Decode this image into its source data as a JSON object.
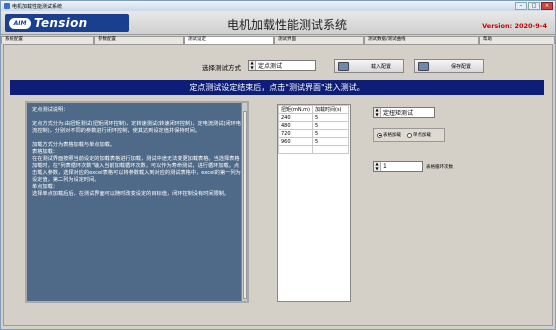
{
  "window": {
    "title": "电机加载性能测试系统"
  },
  "header": {
    "logo_mark": "AIM",
    "logo_text": "Tension",
    "app_title": "电机加载性能测试系统",
    "version": "Version: 2020-9-4"
  },
  "tabs": [
    "系统配置",
    "参数配置",
    "测试设定",
    "测试界面",
    "测试数据/测试曲线",
    "帮助"
  ],
  "active_tab": 2,
  "mode": {
    "label": "选择测试方式",
    "value": "定点测试"
  },
  "buttons": {
    "load": "载入配置",
    "save": "保存配置"
  },
  "banner": "定点测试设定结束后，点击\"测试界面\"进入测试。",
  "description": "定点测试说明：\n\n定点方式分为:由扭矩测试(扭矩闭环控制)，定转速测试(转速闭环控制)，定电流测试(闭环电流控制)，分别对不同的参数进行闭环控制，使其达到设定值并保持时间。\n\n加载方式分为表格加载与单点加载。\n表格加载：\n在在测试界面按照当前设定的加载表格进行加载，测试中途无法变更加载表格。当选择表格加载时，在\"列表循环次数\"输入当前加载循环次数，可以作为寿命测试，进行循环加载。点击载入参数，选择对应的excel表格可以将参数载入到对应的测试表格中，excel的第一列为设定值，第二列为设定时间。\n单点加载：\n选择单点加载后后，在测试界面可以随时改变设定的目标值，闭环控制没有时间限制。",
  "table": {
    "headers": [
      "扭矩(mN.m)",
      "加载时间(s)"
    ],
    "rows": [
      [
        "240",
        "5"
      ],
      [
        "480",
        "5"
      ],
      [
        "720",
        "5"
      ],
      [
        "960",
        "5"
      ]
    ]
  },
  "control_select": "定扭矩测试",
  "load_mode": {
    "options": [
      "表格加载",
      "单点加载"
    ],
    "selected": 0
  },
  "loop": {
    "value": "1",
    "label": "表格循环次数"
  },
  "colors": {
    "banner": "#0e1e78",
    "description_bg": "#4f6a88",
    "version": "#cc0000",
    "logo": "#1a3f8f"
  },
  "icons": {
    "load": "load-config-icon",
    "save": "save-config-icon"
  }
}
